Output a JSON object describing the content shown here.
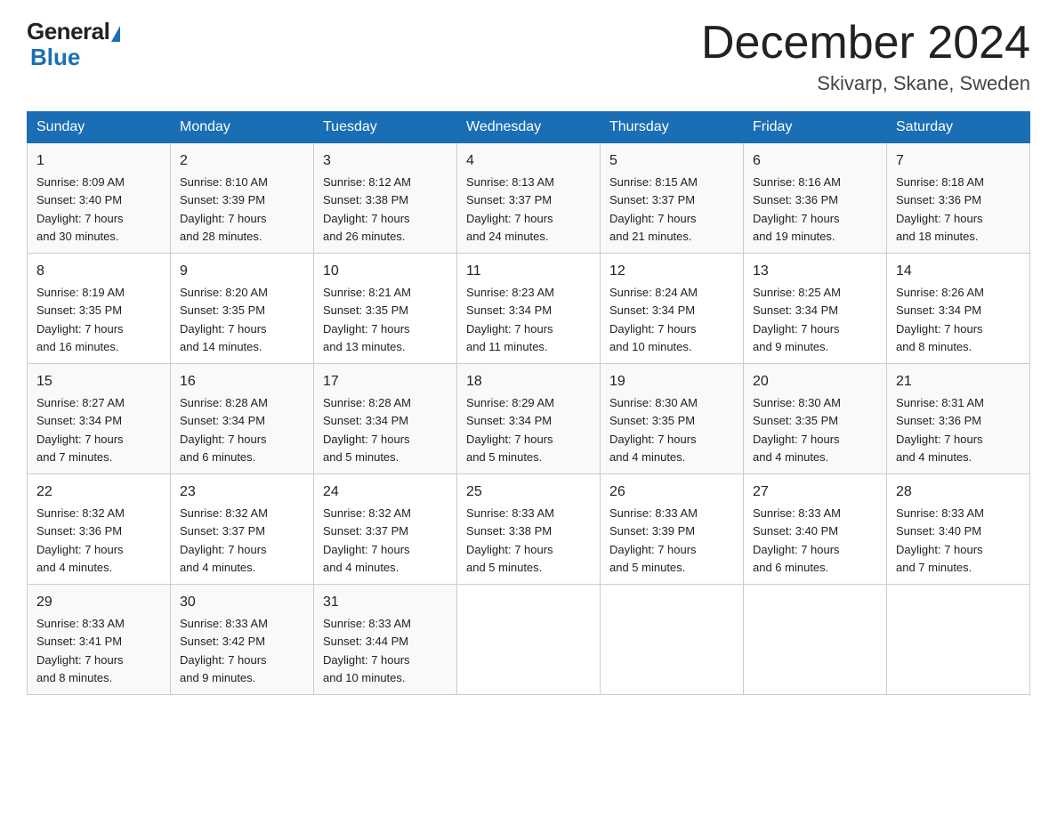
{
  "logo": {
    "general": "General",
    "blue": "Blue",
    "tagline": "Blue"
  },
  "header": {
    "title": "December 2024",
    "subtitle": "Skivarp, Skane, Sweden"
  },
  "days_of_week": [
    "Sunday",
    "Monday",
    "Tuesday",
    "Wednesday",
    "Thursday",
    "Friday",
    "Saturday"
  ],
  "weeks": [
    [
      {
        "day": "1",
        "sunrise": "8:09 AM",
        "sunset": "3:40 PM",
        "daylight": "7 hours and 30 minutes."
      },
      {
        "day": "2",
        "sunrise": "8:10 AM",
        "sunset": "3:39 PM",
        "daylight": "7 hours and 28 minutes."
      },
      {
        "day": "3",
        "sunrise": "8:12 AM",
        "sunset": "3:38 PM",
        "daylight": "7 hours and 26 minutes."
      },
      {
        "day": "4",
        "sunrise": "8:13 AM",
        "sunset": "3:37 PM",
        "daylight": "7 hours and 24 minutes."
      },
      {
        "day": "5",
        "sunrise": "8:15 AM",
        "sunset": "3:37 PM",
        "daylight": "7 hours and 21 minutes."
      },
      {
        "day": "6",
        "sunrise": "8:16 AM",
        "sunset": "3:36 PM",
        "daylight": "7 hours and 19 minutes."
      },
      {
        "day": "7",
        "sunrise": "8:18 AM",
        "sunset": "3:36 PM",
        "daylight": "7 hours and 18 minutes."
      }
    ],
    [
      {
        "day": "8",
        "sunrise": "8:19 AM",
        "sunset": "3:35 PM",
        "daylight": "7 hours and 16 minutes."
      },
      {
        "day": "9",
        "sunrise": "8:20 AM",
        "sunset": "3:35 PM",
        "daylight": "7 hours and 14 minutes."
      },
      {
        "day": "10",
        "sunrise": "8:21 AM",
        "sunset": "3:35 PM",
        "daylight": "7 hours and 13 minutes."
      },
      {
        "day": "11",
        "sunrise": "8:23 AM",
        "sunset": "3:34 PM",
        "daylight": "7 hours and 11 minutes."
      },
      {
        "day": "12",
        "sunrise": "8:24 AM",
        "sunset": "3:34 PM",
        "daylight": "7 hours and 10 minutes."
      },
      {
        "day": "13",
        "sunrise": "8:25 AM",
        "sunset": "3:34 PM",
        "daylight": "7 hours and 9 minutes."
      },
      {
        "day": "14",
        "sunrise": "8:26 AM",
        "sunset": "3:34 PM",
        "daylight": "7 hours and 8 minutes."
      }
    ],
    [
      {
        "day": "15",
        "sunrise": "8:27 AM",
        "sunset": "3:34 PM",
        "daylight": "7 hours and 7 minutes."
      },
      {
        "day": "16",
        "sunrise": "8:28 AM",
        "sunset": "3:34 PM",
        "daylight": "7 hours and 6 minutes."
      },
      {
        "day": "17",
        "sunrise": "8:28 AM",
        "sunset": "3:34 PM",
        "daylight": "7 hours and 5 minutes."
      },
      {
        "day": "18",
        "sunrise": "8:29 AM",
        "sunset": "3:34 PM",
        "daylight": "7 hours and 5 minutes."
      },
      {
        "day": "19",
        "sunrise": "8:30 AM",
        "sunset": "3:35 PM",
        "daylight": "7 hours and 4 minutes."
      },
      {
        "day": "20",
        "sunrise": "8:30 AM",
        "sunset": "3:35 PM",
        "daylight": "7 hours and 4 minutes."
      },
      {
        "day": "21",
        "sunrise": "8:31 AM",
        "sunset": "3:36 PM",
        "daylight": "7 hours and 4 minutes."
      }
    ],
    [
      {
        "day": "22",
        "sunrise": "8:32 AM",
        "sunset": "3:36 PM",
        "daylight": "7 hours and 4 minutes."
      },
      {
        "day": "23",
        "sunrise": "8:32 AM",
        "sunset": "3:37 PM",
        "daylight": "7 hours and 4 minutes."
      },
      {
        "day": "24",
        "sunrise": "8:32 AM",
        "sunset": "3:37 PM",
        "daylight": "7 hours and 4 minutes."
      },
      {
        "day": "25",
        "sunrise": "8:33 AM",
        "sunset": "3:38 PM",
        "daylight": "7 hours and 5 minutes."
      },
      {
        "day": "26",
        "sunrise": "8:33 AM",
        "sunset": "3:39 PM",
        "daylight": "7 hours and 5 minutes."
      },
      {
        "day": "27",
        "sunrise": "8:33 AM",
        "sunset": "3:40 PM",
        "daylight": "7 hours and 6 minutes."
      },
      {
        "day": "28",
        "sunrise": "8:33 AM",
        "sunset": "3:40 PM",
        "daylight": "7 hours and 7 minutes."
      }
    ],
    [
      {
        "day": "29",
        "sunrise": "8:33 AM",
        "sunset": "3:41 PM",
        "daylight": "7 hours and 8 minutes."
      },
      {
        "day": "30",
        "sunrise": "8:33 AM",
        "sunset": "3:42 PM",
        "daylight": "7 hours and 9 minutes."
      },
      {
        "day": "31",
        "sunrise": "8:33 AM",
        "sunset": "3:44 PM",
        "daylight": "7 hours and 10 minutes."
      },
      null,
      null,
      null,
      null
    ]
  ],
  "labels": {
    "sunrise": "Sunrise:",
    "sunset": "Sunset:",
    "daylight": "Daylight:"
  }
}
